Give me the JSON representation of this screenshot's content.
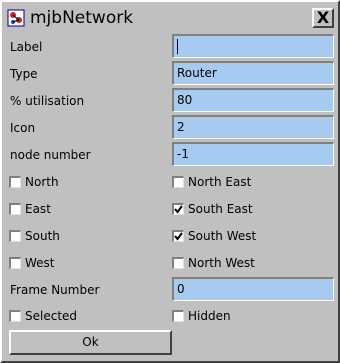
{
  "window": {
    "title": "mjbNetwork",
    "close_label": "X"
  },
  "fields": {
    "label": {
      "caption": "Label",
      "value": ""
    },
    "type": {
      "caption": "Type",
      "value": "Router"
    },
    "utilisation": {
      "caption": "% utilisation",
      "value": "80"
    },
    "icon": {
      "caption": "Icon",
      "value": "2"
    },
    "node_number": {
      "caption": "node number",
      "value": "-1"
    },
    "frame_number": {
      "caption": "Frame Number",
      "value": "0"
    }
  },
  "checkboxes": {
    "north": {
      "label": "North",
      "checked": false
    },
    "north_east": {
      "label": "North East",
      "checked": false
    },
    "east": {
      "label": "East",
      "checked": false
    },
    "south_east": {
      "label": "South East",
      "checked": true
    },
    "south": {
      "label": "South",
      "checked": false
    },
    "south_west": {
      "label": "South West",
      "checked": true
    },
    "west": {
      "label": "West",
      "checked": false
    },
    "north_west": {
      "label": "North West",
      "checked": false
    },
    "selected": {
      "label": "Selected",
      "checked": false
    },
    "hidden": {
      "label": "Hidden",
      "checked": false
    }
  },
  "ok_button": {
    "label": "Ok"
  }
}
